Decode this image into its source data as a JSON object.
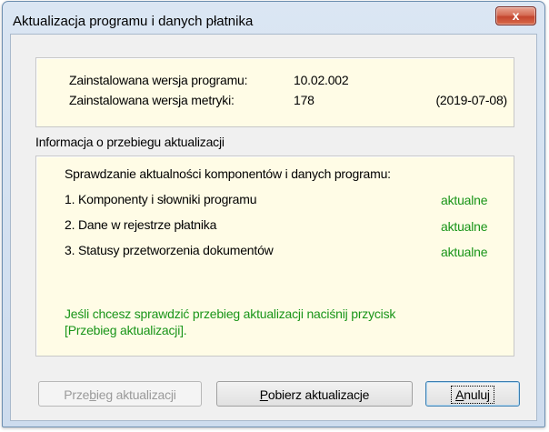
{
  "window": {
    "title": "Aktualizacja programu i danych płatnika",
    "close_label": "x"
  },
  "version": {
    "program_label": "Zainstalowana wersja programu:",
    "program_value": "10.02.002",
    "metric_label": "Zainstalowana wersja metryki:",
    "metric_value": "178",
    "metric_date": "(2019-07-08)"
  },
  "info": {
    "section_title": "Informacja o przebiegu aktualizacji",
    "checking_text": "Sprawdzanie aktualności komponentów i danych programu:",
    "items": [
      {
        "label": "1. Komponenty i słowniki programu",
        "status": "aktualne"
      },
      {
        "label": "2. Dane w rejestrze płatnika",
        "status": "aktualne"
      },
      {
        "label": "3. Statusy przetworzenia dokumentów",
        "status": "aktualne"
      }
    ],
    "hint_line1": "Jeśli chcesz sprawdzić przebieg aktualizacji naciśnij przycisk",
    "hint_line2": "[Przebieg aktualizacji]."
  },
  "buttons": {
    "progress": {
      "pre": "Prze",
      "hot": "b",
      "post": "ieg aktualizacji"
    },
    "download": {
      "pre": "",
      "hot": "P",
      "post": "obierz aktualizacje"
    },
    "cancel": {
      "pre": "",
      "hot": "A",
      "post": "nuluj"
    }
  },
  "colors": {
    "panel_bg": "#fffce6",
    "status_green": "#199519",
    "close_red": "#c4462f"
  }
}
